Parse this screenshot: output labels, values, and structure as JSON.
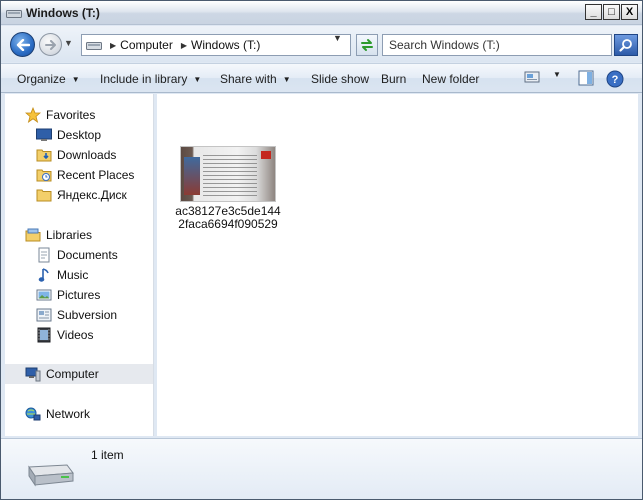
{
  "window": {
    "title": "Windows (T:)"
  },
  "caption_buttons": {
    "minimize": "_",
    "maximize": "□",
    "close": "X"
  },
  "address": {
    "crumbs": [
      "Computer",
      "Windows (T:)"
    ],
    "search_placeholder": "Search Windows (T:)"
  },
  "toolbar": {
    "organize": "Organize",
    "include_in_library": "Include in library",
    "share_with": "Share with",
    "slide_show": "Slide show",
    "burn": "Burn",
    "new_folder": "New folder"
  },
  "nav": {
    "favorites": {
      "header": "Favorites",
      "items": [
        "Desktop",
        "Downloads",
        "Recent Places",
        "Яндекс.Диск"
      ]
    },
    "libraries": {
      "header": "Libraries",
      "items": [
        "Documents",
        "Music",
        "Pictures",
        "Subversion",
        "Videos"
      ]
    },
    "computer": "Computer",
    "network": "Network"
  },
  "content": {
    "files": [
      {
        "name": "ac38127e3c5de1442faca6694f090529",
        "icon": "image-thumbnail"
      }
    ]
  },
  "details": {
    "item_count": "1 item"
  },
  "colors": {
    "accent": "#2a6cc4",
    "selection": "#e6e9ee",
    "chrome": "#dfe8f3"
  }
}
